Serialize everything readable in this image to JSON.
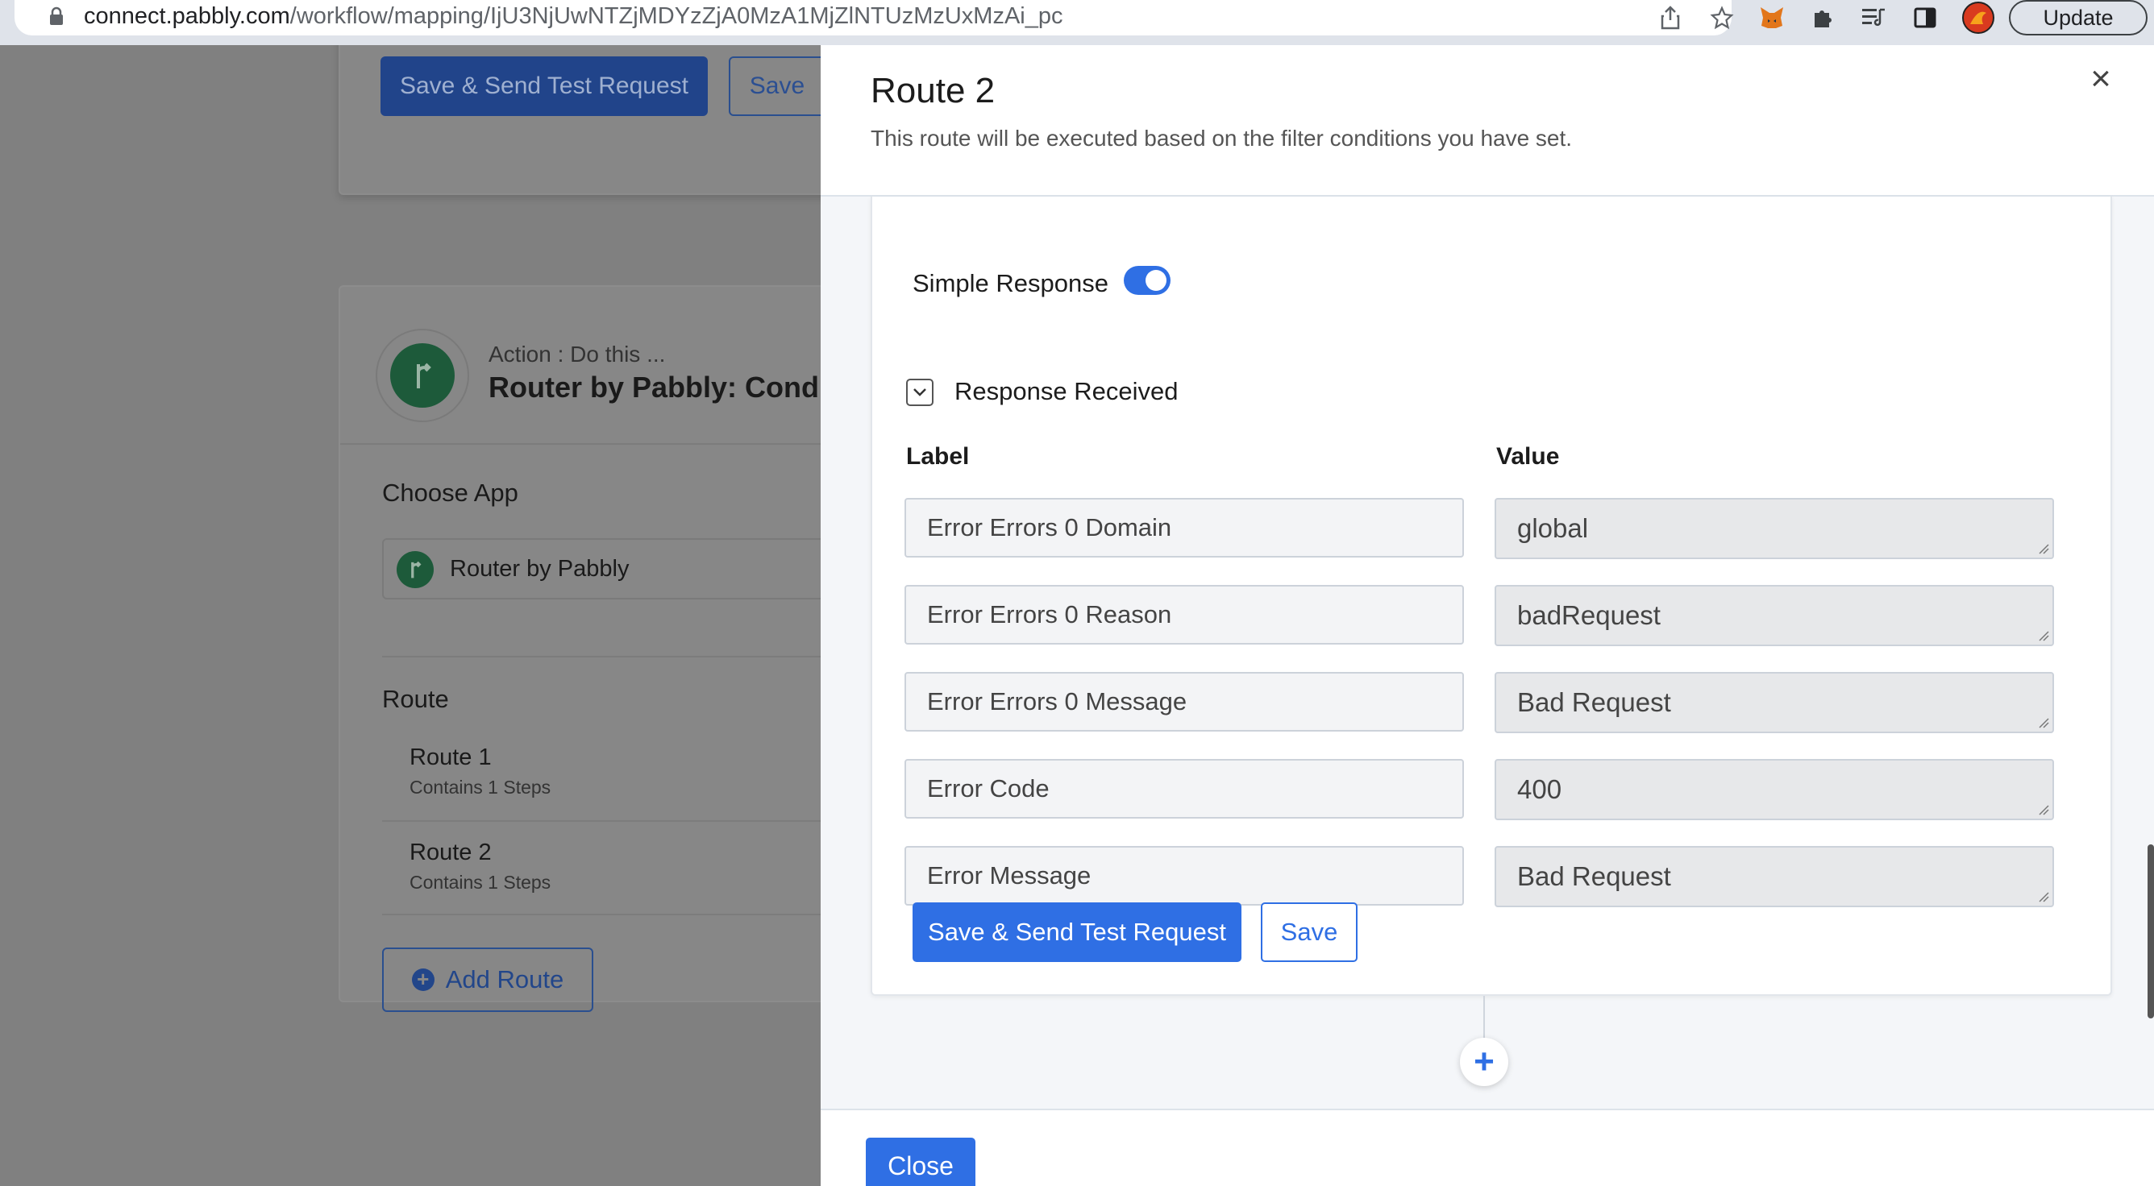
{
  "browser": {
    "url_host": "connect.pabbly.com",
    "url_path": "/workflow/mapping/IjU3NjUwNTZjMDYzZjA0MzA1MjZlNTUzMzUxMzAi_pc",
    "update_label": "Update"
  },
  "background": {
    "top_buttons": {
      "primary": "Save & Send Test Request",
      "secondary": "Save"
    },
    "action_subtitle": "Action : Do this ...",
    "action_title": "Router by Pabbly: Condit",
    "choose_app_label": "Choose App",
    "selected_app": "Router by Pabbly",
    "route_label": "Route",
    "routes": [
      {
        "title": "Route 1",
        "steps": "Contains 1 Steps"
      },
      {
        "title": "Route 2",
        "steps": "Contains 1 Steps"
      }
    ],
    "add_route_label": "Add Route"
  },
  "modal": {
    "title": "Route 2",
    "description": "This route will be executed based on the filter conditions you have set.",
    "simple_response_label": "Simple Response",
    "simple_response_on": true,
    "response_section_title": "Response Received",
    "label_header": "Label",
    "value_header": "Value",
    "fields": [
      {
        "label": "Error Errors 0 Domain",
        "value": "global"
      },
      {
        "label": "Error Errors 0 Reason",
        "value": "badRequest"
      },
      {
        "label": "Error Errors 0 Message",
        "value": "Bad Request"
      },
      {
        "label": "Error Code",
        "value": "400"
      },
      {
        "label": "Error Message",
        "value": "Bad Request"
      }
    ],
    "save_test_label": "Save & Send Test Request",
    "save_label": "Save",
    "add_step_symbol": "+",
    "close_label": "Close"
  },
  "colors": {
    "primary": "#2f6fe4",
    "overlay": "#808080",
    "router_green": "#1d5a3a"
  }
}
